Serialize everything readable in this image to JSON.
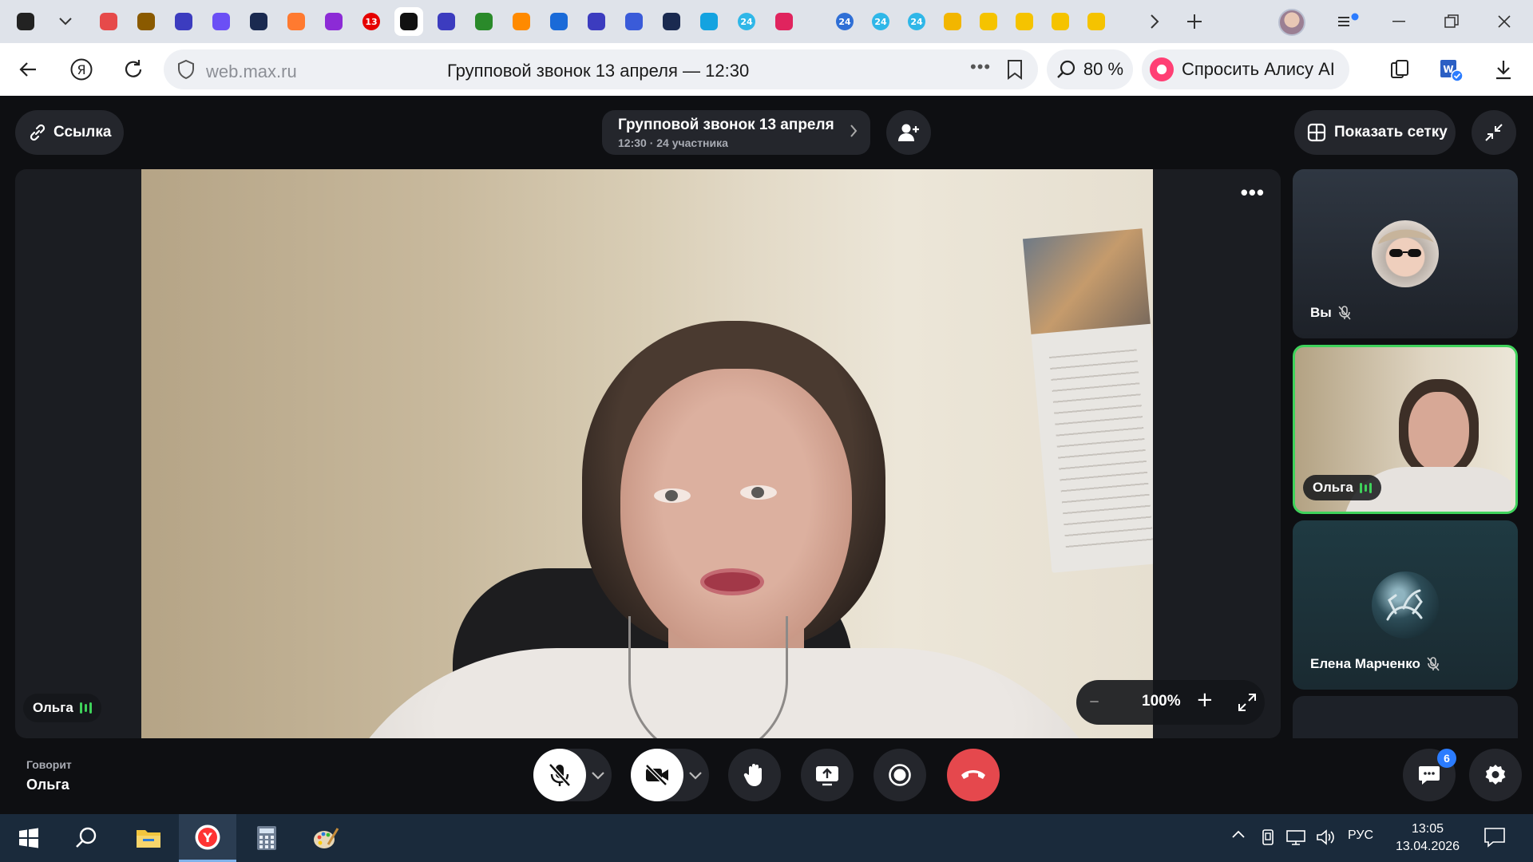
{
  "browser": {
    "tabs_favicons": [
      {
        "icon": "speaker-icon",
        "color": "#222222"
      },
      {
        "icon": "mail-icon",
        "color": "#e64a4a"
      },
      {
        "icon": "hm-icon",
        "color": "#8a5a00"
      },
      {
        "icon": "cube-icon",
        "color": "#3c3cbf"
      },
      {
        "icon": "star-icon",
        "color": "#6b4ff5"
      },
      {
        "icon": "swirl-icon",
        "color": "#1a2a50"
      },
      {
        "icon": "pdf-icon",
        "color": "#ff7a30"
      },
      {
        "icon": "face-icon",
        "color": "#8c2bd6"
      },
      {
        "icon": "calendar-13-icon",
        "color": "#e60000",
        "text": "13"
      },
      {
        "icon": "speaker-icon",
        "color": "#111111",
        "active": true
      },
      {
        "icon": "cube-icon",
        "color": "#3c3cbf"
      },
      {
        "icon": "leaf-icon",
        "color": "#2a8a2a"
      },
      {
        "icon": "envelope-icon",
        "color": "#ff8a00"
      },
      {
        "icon": "link-icon",
        "color": "#1a6ad8"
      },
      {
        "icon": "cube-icon",
        "color": "#3c3cbf"
      },
      {
        "icon": "feather-icon",
        "color": "#3a5bd9"
      },
      {
        "icon": "swirl-icon",
        "color": "#1a2a50"
      },
      {
        "icon": "app-icon",
        "color": "#14a3e0"
      },
      {
        "icon": "bitrix-icon",
        "color": "#2fb7e8",
        "text": "24"
      },
      {
        "icon": "ring-icon",
        "color": "#e0245e"
      },
      {
        "icon": "bitrix-icon",
        "color": "#2f6fd6",
        "text": "24"
      },
      {
        "icon": "bitrix-icon",
        "color": "#2fb7e8",
        "text": "24"
      },
      {
        "icon": "bitrix-icon",
        "color": "#2fb7e8",
        "text": "24"
      },
      {
        "icon": "pinwheel-icon",
        "color": "#f2b600"
      },
      {
        "icon": "note-icon",
        "color": "#f5c300"
      },
      {
        "icon": "play-icon",
        "color": "#f5c300"
      },
      {
        "icon": "play-icon",
        "color": "#f5c300"
      },
      {
        "icon": "play-icon",
        "color": "#f5c300"
      }
    ],
    "url": "web.max.ru",
    "page_title": "Групповой звонок 13 апреля — 12:30",
    "zoom": "80 %",
    "ask_alice": "Спросить Алису AI"
  },
  "call": {
    "link_label": "Ссылка",
    "title": "Групповой звонок 13 апреля",
    "subtitle": "12:30 · 24 участника",
    "show_grid_label": "Показать сетку",
    "main_speaker_name": "Ольга",
    "zoom_level": "100%"
  },
  "participants": [
    {
      "name": "Вы",
      "muted": true
    },
    {
      "name": "Ольга",
      "speaking": true
    },
    {
      "name": "Елена Марченко",
      "muted": true
    }
  ],
  "bottom": {
    "speaking_label": "Говорит",
    "speaking_name": "Ольга",
    "chat_badge": "6"
  },
  "taskbar": {
    "language": "РУС",
    "time": "13:05",
    "date": "13.04.2026"
  },
  "colors": {
    "accent_green": "#3fd25b",
    "hangup_red": "#e5484d",
    "badge_blue": "#2b7cff"
  }
}
